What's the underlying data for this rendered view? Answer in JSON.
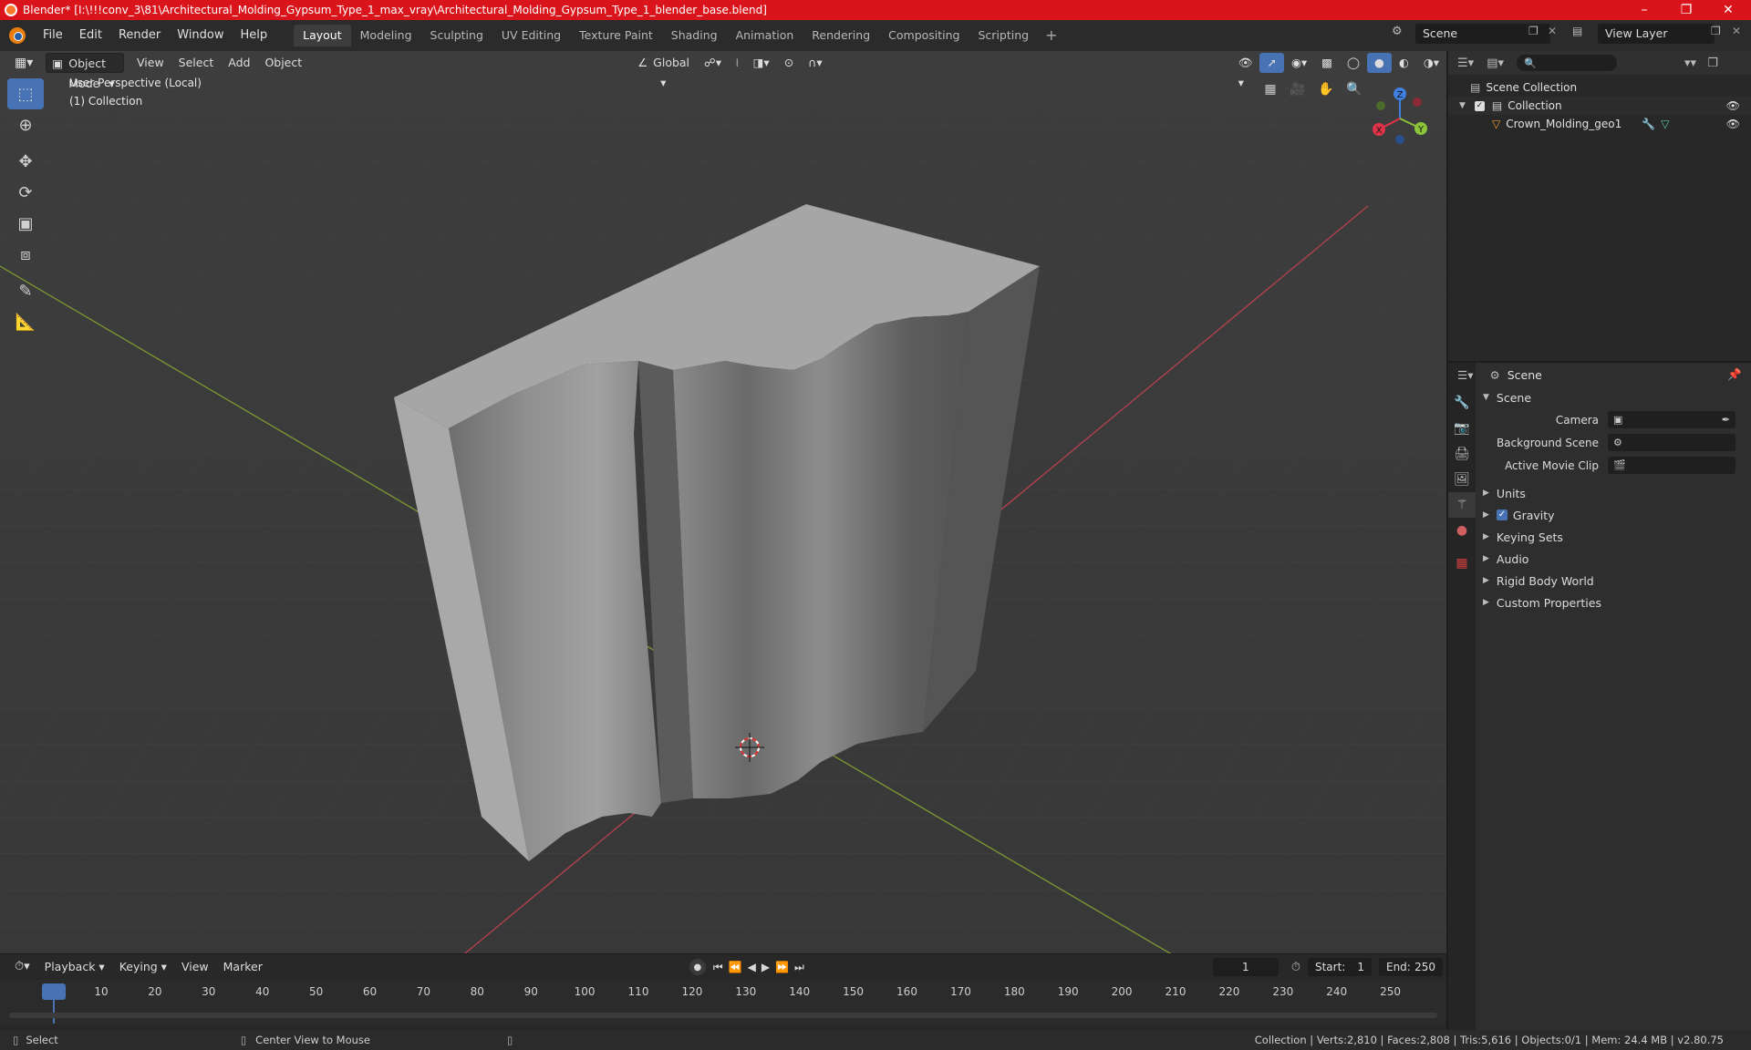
{
  "window": {
    "title": "Blender* [I:\\!!!conv_3\\81\\Architectural_Molding_Gypsum_Type_1_max_vray\\Architectural_Molding_Gypsum_Type_1_blender_base.blend]",
    "controls": [
      "–",
      "❐",
      "✕"
    ]
  },
  "menu": {
    "items": [
      "File",
      "Edit",
      "Render",
      "Window",
      "Help"
    ],
    "workspaces": [
      "Layout",
      "Modeling",
      "Sculpting",
      "UV Editing",
      "Texture Paint",
      "Shading",
      "Animation",
      "Rendering",
      "Compositing",
      "Scripting"
    ],
    "add_workspace": "+",
    "scene": "Scene",
    "view_layer": "View Layer"
  },
  "viewport": {
    "mode": "Object Mode",
    "menus": [
      "View",
      "Select",
      "Add",
      "Object"
    ],
    "orientation": "Global",
    "info_line1": "User Perspective (Local)",
    "info_line2": "(1) Collection",
    "gizmo": {
      "x": "X",
      "y": "Y",
      "z": "Z"
    }
  },
  "outliner": {
    "search_placeholder": "",
    "root": "Scene Collection",
    "collection": "Collection",
    "object": "Crown_Molding_geo1"
  },
  "properties": {
    "context": "Scene",
    "panel_title": "Scene",
    "fields": [
      {
        "label": "Camera",
        "value": ""
      },
      {
        "label": "Background Scene",
        "value": ""
      },
      {
        "label": "Active Movie Clip",
        "value": ""
      }
    ],
    "panels": [
      "Units",
      "Gravity",
      "Keying Sets",
      "Audio",
      "Rigid Body World",
      "Custom Properties"
    ],
    "gravity_checked": true
  },
  "timeline": {
    "menus": [
      "Playback",
      "Keying",
      "View",
      "Marker"
    ],
    "current_frame": "1",
    "start_label": "Start:",
    "start": "1",
    "end_label": "End:",
    "end": "250",
    "ticks": [
      "1",
      "10",
      "20",
      "30",
      "40",
      "50",
      "60",
      "70",
      "80",
      "90",
      "100",
      "110",
      "120",
      "130",
      "140",
      "150",
      "160",
      "170",
      "180",
      "190",
      "200",
      "210",
      "220",
      "230",
      "240",
      "250"
    ]
  },
  "status": {
    "select": "Select",
    "center_view": "Center View to Mouse",
    "stats": "Collection | Verts:2,810 | Faces:2,808 | Tris:5,616 | Objects:0/1 | Mem: 24.4 MB | v2.80.75"
  },
  "colors": {
    "title_bar": "#d9141b",
    "accent": "#4772b3",
    "x_axis": "#e0334a",
    "y_axis": "#8bc33a",
    "z_axis": "#3f7fe0"
  }
}
